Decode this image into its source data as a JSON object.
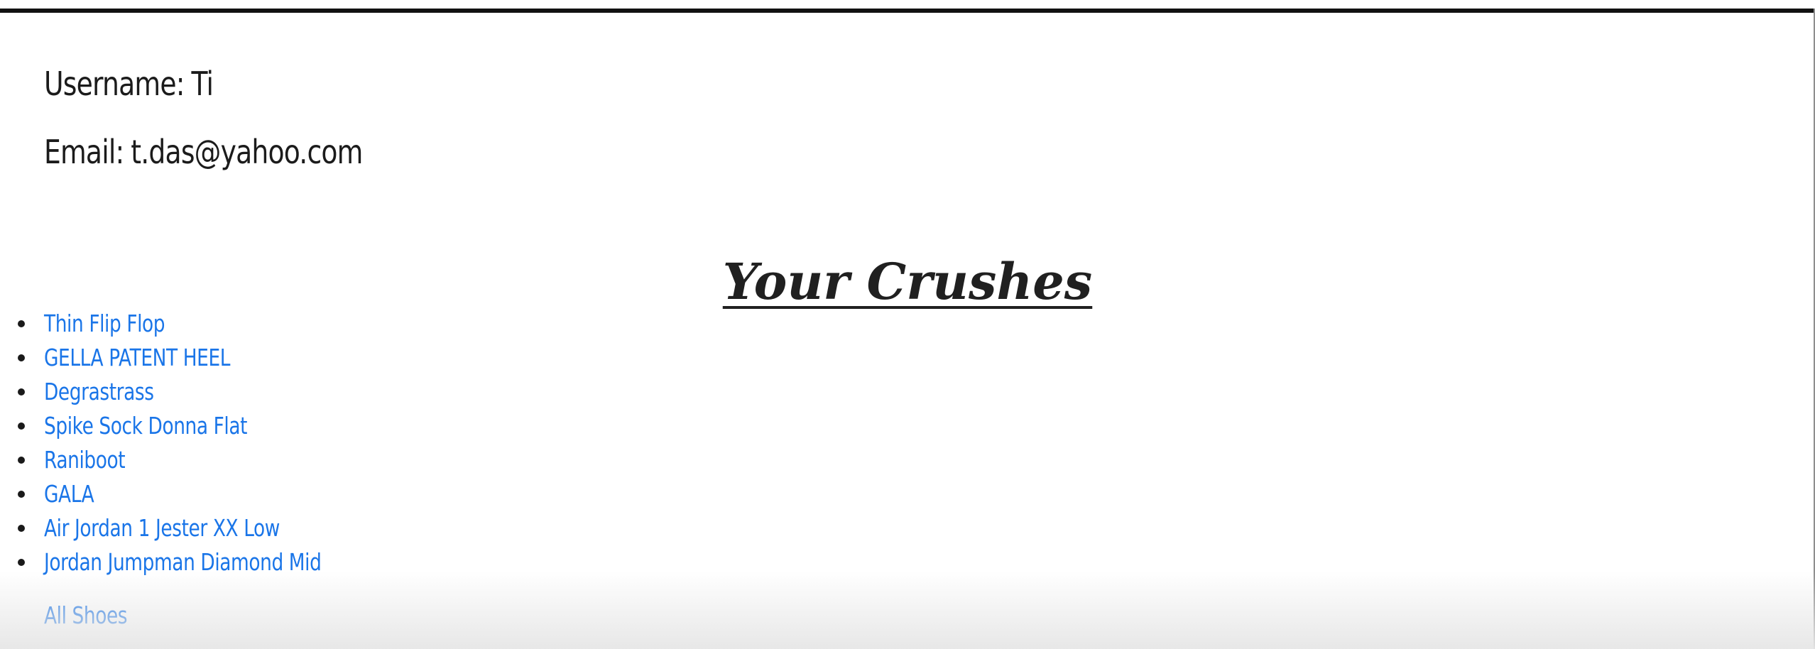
{
  "profile": {
    "username_label": "Username:",
    "username_value": "Ti",
    "email_label": "Email:",
    "email_value": "t.das@yahoo.com"
  },
  "crushes": {
    "title": "Your Crushes",
    "items": [
      "Thin Flip Flop",
      "GELLA PATENT HEEL",
      "Degrastrass",
      "Spike Sock Donna Flat",
      "Raniboot",
      "GALA",
      "Air Jordan 1 Jester XX Low",
      "Jordan Jumpman Diamond Mid"
    ],
    "all_shoes_label": "All Shoes"
  },
  "colors": {
    "link": "#1a75e8",
    "text": "#1c1c1c",
    "border": "#111111"
  }
}
